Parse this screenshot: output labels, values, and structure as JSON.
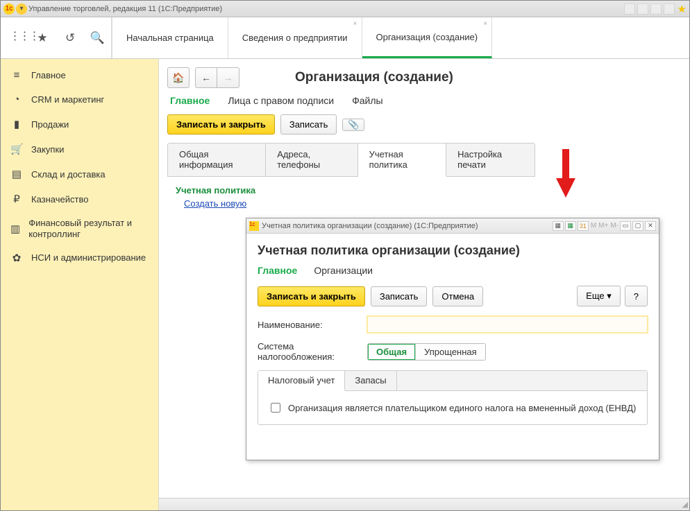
{
  "window_title": "Управление торговлей, редакция 11  (1С:Предприятие)",
  "main_tabs": {
    "home": "Начальная страница",
    "info": "Сведения о предприятии",
    "org": "Организация (создание)"
  },
  "sidebar": {
    "items": [
      {
        "icon": "≡",
        "label": "Главное"
      },
      {
        "icon": "◔",
        "label": "CRM и маркетинг"
      },
      {
        "icon": "▮",
        "label": "Продажи"
      },
      {
        "icon": "🛒",
        "label": "Закупки"
      },
      {
        "icon": "▤",
        "label": "Склад и доставка"
      },
      {
        "icon": "₽",
        "label": "Казначейство"
      },
      {
        "icon": "▥",
        "label": "Финансовый результат и контроллинг"
      },
      {
        "icon": "✿",
        "label": "НСИ и администрирование"
      }
    ]
  },
  "page": {
    "title": "Организация (создание)",
    "subnav": {
      "main": "Главное",
      "signers": "Лица с правом подписи",
      "files": "Файлы"
    },
    "save_close": "Записать и закрыть",
    "save": "Записать",
    "tabs": {
      "general": "Общая информация",
      "addr": "Адреса, телефоны",
      "policy": "Учетная политика",
      "print": "Настройка печати"
    },
    "section": "Учетная политика",
    "create_link": "Создать новую"
  },
  "modal": {
    "win_title": "Учетная политика организации (создание)  (1С:Предприятие)",
    "title": "Учетная политика организации (создание)",
    "subnav": {
      "main": "Главное",
      "orgs": "Организации"
    },
    "save_close": "Записать и закрыть",
    "save": "Записать",
    "cancel": "Отмена",
    "more": "Еще",
    "help": "?",
    "field_name": "Наименование:",
    "name_value": "",
    "field_tax": "Система налогообложения:",
    "tax_general": "Общая",
    "tax_simple": "Упрощенная",
    "inner_tabs": {
      "tax": "Налоговый учет",
      "stock": "Запасы"
    },
    "envd_label": "Организация является плательщиком единого налога на вмененный доход (ЕНВД)"
  }
}
